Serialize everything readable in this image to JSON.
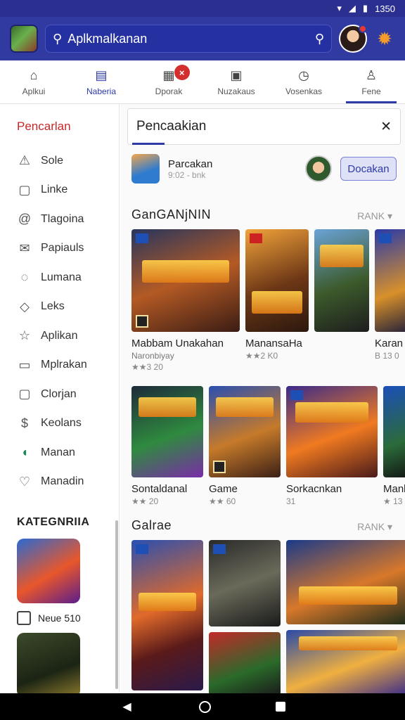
{
  "status_bar": {
    "time": "1350",
    "icons": [
      "wifi-icon",
      "signal-icon",
      "battery-icon"
    ]
  },
  "app_bar": {
    "search_text": "Aplkmalkanan",
    "accent": "#303aa0"
  },
  "tabs": [
    {
      "label": "Aplkui",
      "icon": "home-icon"
    },
    {
      "label": "Naberia",
      "icon": "list-icon"
    },
    {
      "label": "Dporak",
      "icon": "calendar-icon",
      "badge": "×"
    },
    {
      "label": "Nuzakaus",
      "icon": "image-icon"
    },
    {
      "label": "Vosenkas",
      "icon": "clock-icon"
    },
    {
      "label": "Fene",
      "icon": "person-icon"
    }
  ],
  "sidebar": {
    "title": "Pencarlan",
    "items": [
      {
        "label": "Sole",
        "icon": "warning-icon"
      },
      {
        "label": "Linke",
        "icon": "bookmark-icon"
      },
      {
        "label": "Tlagoina",
        "icon": "at-icon"
      },
      {
        "label": "Papiauls",
        "icon": "mail-icon"
      },
      {
        "label": "Lumana",
        "icon": "chat-icon"
      },
      {
        "label": "Leks",
        "icon": "tag-icon"
      },
      {
        "label": "Aplikan",
        "icon": "star-icon"
      },
      {
        "label": "Mplrakan",
        "icon": "inbox-icon"
      },
      {
        "label": "Clorjan",
        "icon": "square-icon"
      },
      {
        "label": "Keolans",
        "icon": "dollar-icon"
      },
      {
        "label": "Manan",
        "icon": "headset-icon"
      },
      {
        "label": "Manadin",
        "icon": "heart-icon"
      }
    ],
    "category_title": "KATEGNRIIA",
    "category_label": "Neue 510"
  },
  "main": {
    "search_value": "Pencaakian",
    "result": {
      "title": "Parcakan",
      "subtitle": "9:02 - bnk",
      "button": "Docakan"
    },
    "section1": {
      "title": "GanGANjNIN",
      "more": "RANK",
      "cards": [
        {
          "name": "Mabbam Unakahan",
          "meta": "Naronbiyay",
          "rating": "★★3 20"
        },
        {
          "name": "ManansaHa",
          "meta": "",
          "rating": "★★2 K0"
        },
        {
          "name": "",
          "meta": "",
          "rating": ""
        },
        {
          "name": "Karan",
          "meta": "",
          "rating": "B 13 0"
        }
      ]
    },
    "section2": {
      "cards": [
        {
          "name": "Sontaldanal",
          "rating": "★★ 20"
        },
        {
          "name": "Game",
          "rating": "★★ 60"
        },
        {
          "name": "Sorkacnkan",
          "rating": "31"
        },
        {
          "name": "Manb",
          "rating": "★ 13"
        }
      ]
    },
    "section3": {
      "title": "Galrae",
      "more": "RANK"
    }
  }
}
